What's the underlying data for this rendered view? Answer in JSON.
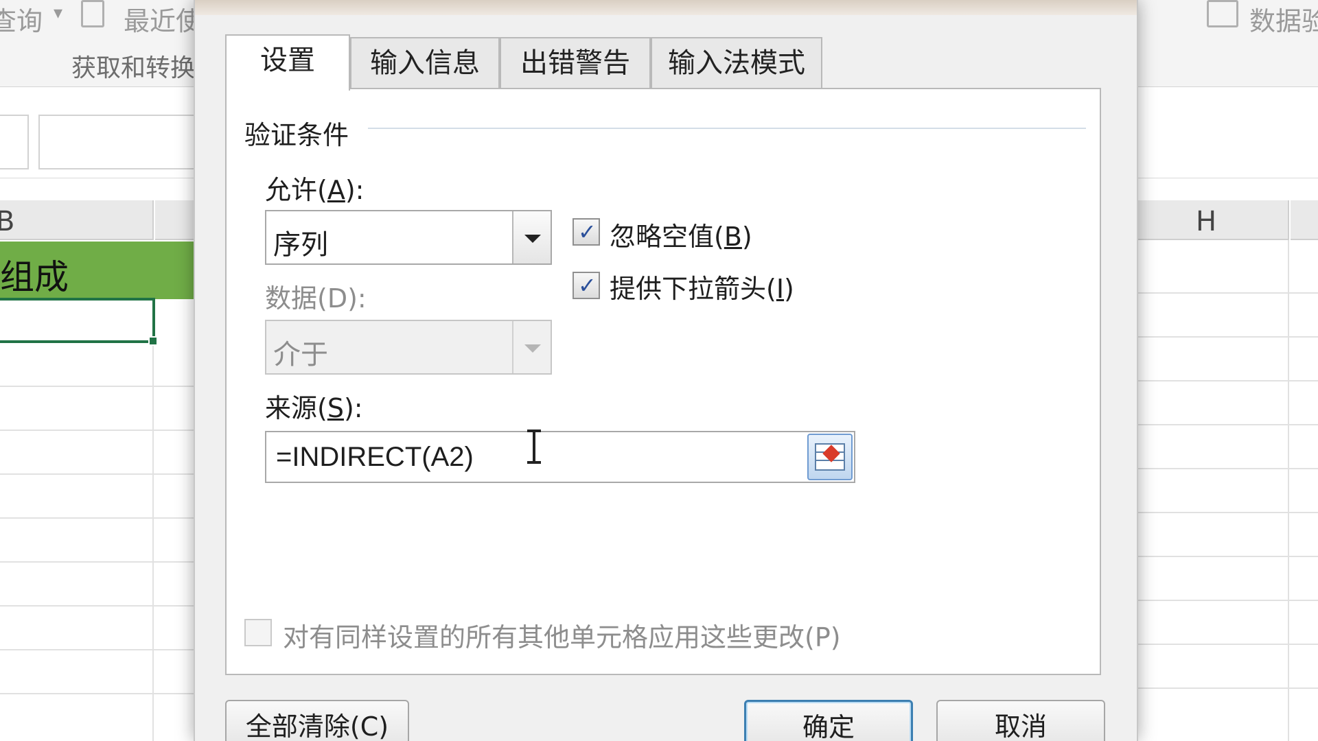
{
  "excel": {
    "ribbon": {
      "query_label": "查询",
      "recent_label": "最近使",
      "group_label": "获取和转换",
      "data_tools_label": "数据验"
    },
    "sheet": {
      "col_b_label": "B",
      "col_h_label": "H",
      "cell_text": "组成"
    }
  },
  "dialog": {
    "tabs": [
      {
        "label": "设置"
      },
      {
        "label": "输入信息"
      },
      {
        "label": "出错警告"
      },
      {
        "label": "输入法模式"
      }
    ],
    "section_title": "验证条件",
    "allow": {
      "label_pre": "允许(",
      "key": "A",
      "label_post": "):",
      "value": "序列"
    },
    "data": {
      "label": "数据(D):",
      "value": "介于"
    },
    "ignore_blank": {
      "label_pre": "忽略空值(",
      "key": "B",
      "label_post": ")",
      "checked": true
    },
    "in_cell_dropdown": {
      "label_pre": "提供下拉箭头(",
      "key": "I",
      "label_post": ")",
      "checked": true
    },
    "source": {
      "label_pre": "来源(",
      "key": "S",
      "label_post": "):",
      "value": "=INDIRECT(A2)"
    },
    "apply_all": {
      "label": "对有同样设置的所有其他单元格应用这些更改(P)",
      "checked": false
    },
    "buttons": {
      "clear_all": "全部清除(C)",
      "ok": "确定",
      "cancel": "取消"
    },
    "check_mark": "✓"
  }
}
